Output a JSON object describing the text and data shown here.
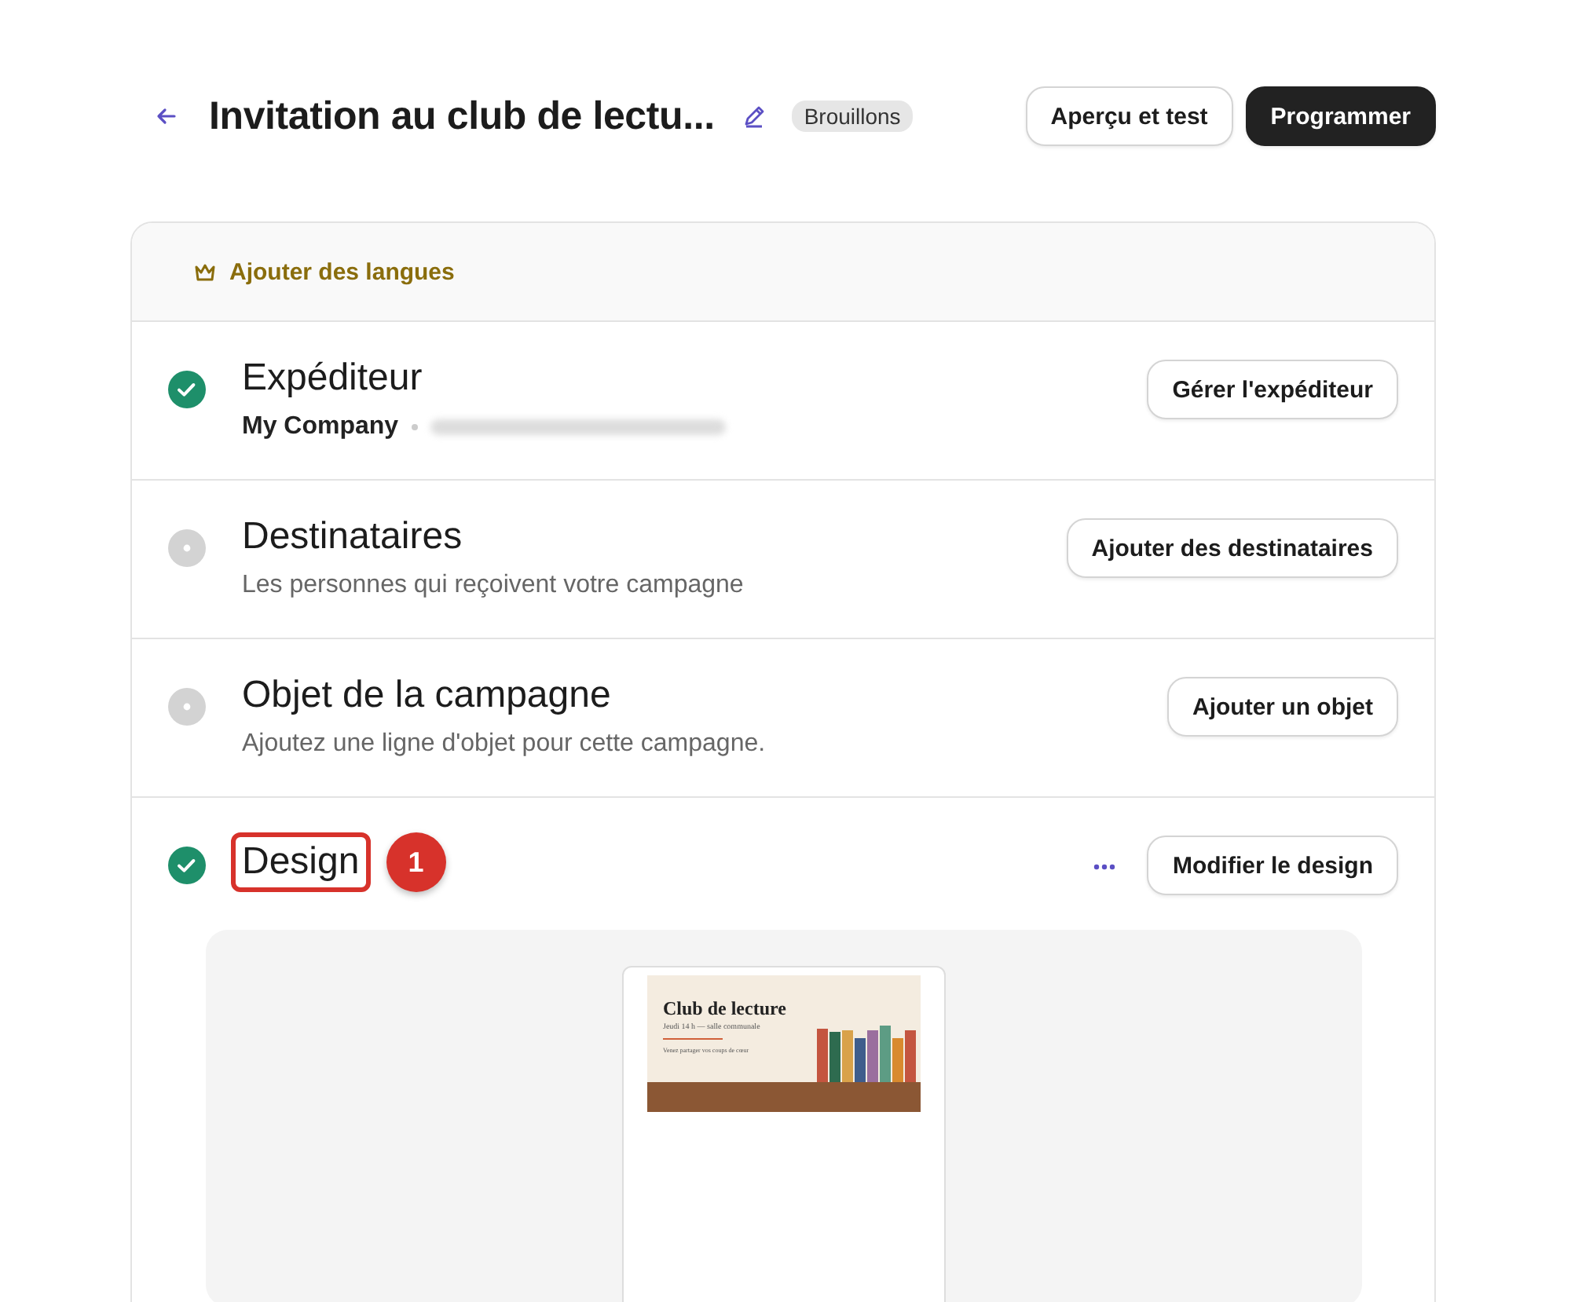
{
  "header": {
    "title": "Invitation au club de lectu...",
    "status": "Brouillons",
    "buttons": [
      {
        "label": "Aperçu et test",
        "kind": "secondary"
      },
      {
        "label": "Programmer",
        "kind": "primary"
      }
    ]
  },
  "upsell": {
    "label": "Ajouter des langues"
  },
  "steps": [
    {
      "kind": "sender",
      "title": "Expéditeur",
      "done": true,
      "company": "My Company",
      "action": "Gérer l'expéditeur"
    },
    {
      "kind": "text",
      "title": "Destinataires",
      "done": false,
      "subtitle": "Les personnes qui reçoivent votre campagne",
      "action": "Ajouter des destinataires"
    },
    {
      "kind": "text",
      "title": "Objet de la campagne",
      "done": false,
      "subtitle": "Ajoutez une ligne d'objet pour cette campagne.",
      "action": "Ajouter un objet"
    },
    {
      "kind": "design",
      "title": "Design",
      "done": true,
      "callout": "1",
      "action": "Modifier le design",
      "preview": {
        "heading": "Club de lecture",
        "line": "Jeudi 14 h — salle communale",
        "note": "Venez partager vos coups de cœur"
      }
    }
  ]
}
